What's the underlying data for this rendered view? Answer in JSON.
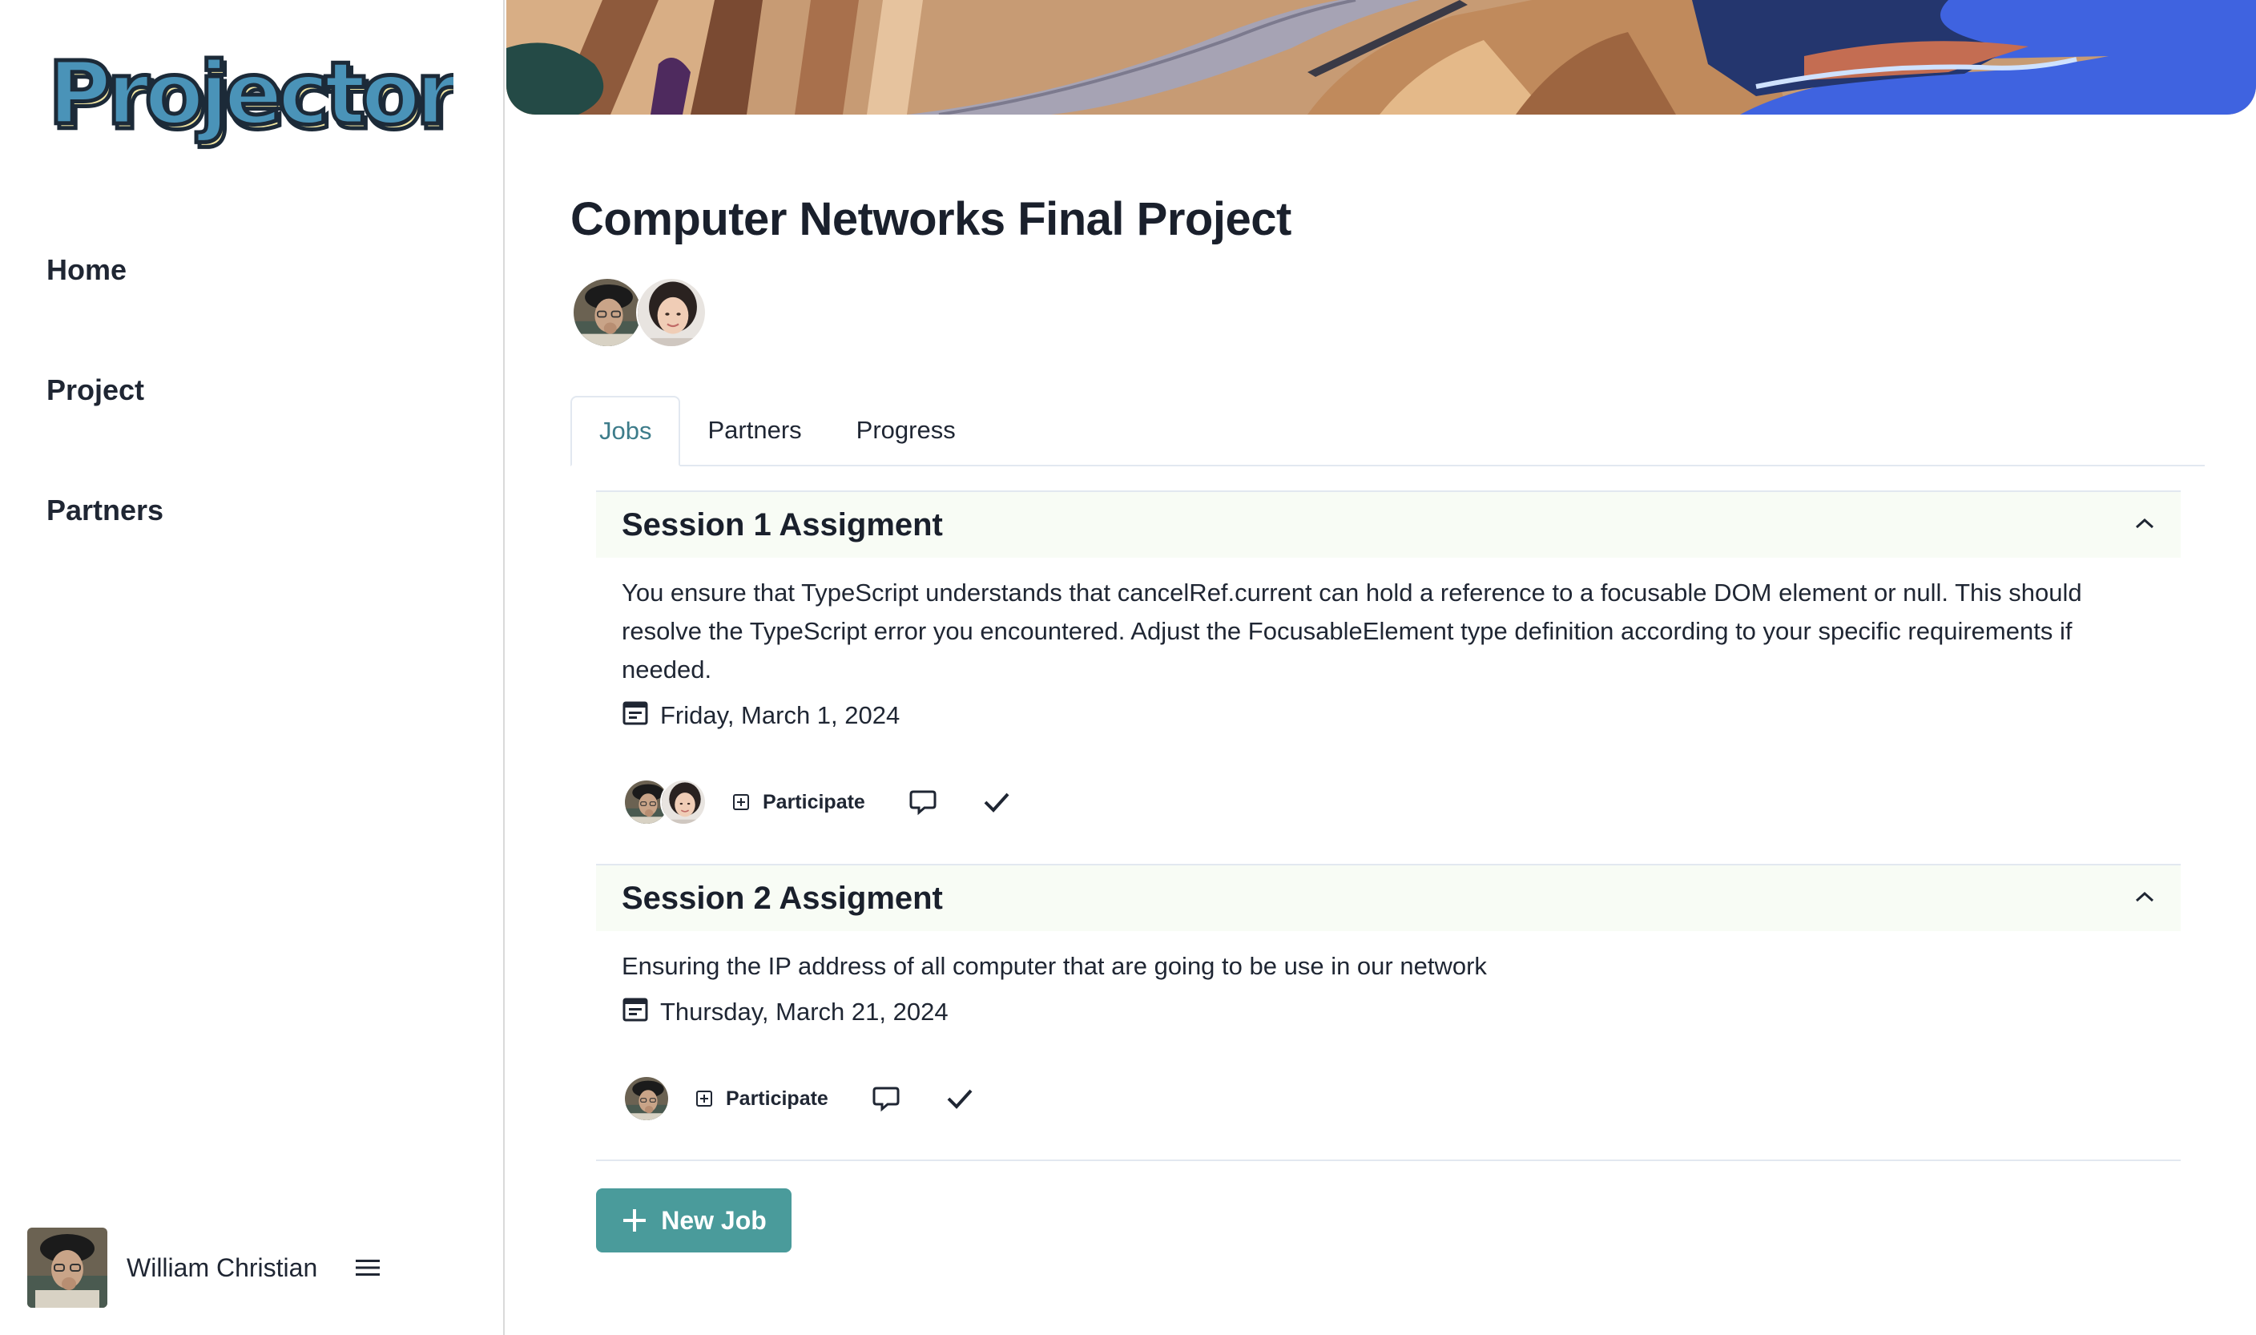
{
  "app": {
    "logo_text": "Projector"
  },
  "sidebar": {
    "nav": [
      {
        "label": "Home"
      },
      {
        "label": "Project"
      },
      {
        "label": "Partners"
      }
    ],
    "user": {
      "name": "William Christian"
    }
  },
  "project": {
    "title": "Computer Networks Final Project",
    "members": [
      "William Christian",
      "Partner"
    ]
  },
  "tabs": [
    {
      "label": "Jobs",
      "active": true
    },
    {
      "label": "Partners",
      "active": false
    },
    {
      "label": "Progress",
      "active": false
    }
  ],
  "jobs": [
    {
      "title": "Session 1 Assigment",
      "description": "You ensure that TypeScript understands that cancelRef.current can hold a reference to a focusable DOM element or null. This should resolve the TypeScript error you encountered. Adjust the FocusableElement type definition according to your specific requirements if needed.",
      "date": "Friday, March 1, 2024",
      "participate_label": "Participate",
      "participants": 2
    },
    {
      "title": "Session 2 Assigment",
      "description": "Ensuring the IP address of all computer that are going to be use in our network",
      "date": "Thursday, March 21, 2024",
      "participate_label": "Participate",
      "participants": 1
    }
  ],
  "actions": {
    "new_job_label": "New Job"
  },
  "colors": {
    "accent": "#4a9b9b",
    "active_tab": "#3d7c8a",
    "job_header_bg": "#f8fcf5"
  }
}
